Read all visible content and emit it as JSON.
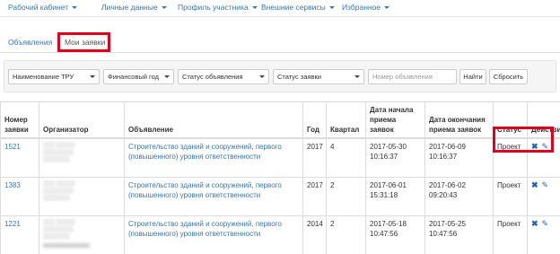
{
  "nav": {
    "items": [
      {
        "label": "Рабочий кабинет"
      },
      {
        "label": "Личные данные"
      },
      {
        "label": "Профиль участника"
      },
      {
        "label": "Внешние сервисы"
      },
      {
        "label": "Избранное"
      }
    ]
  },
  "tabs": [
    {
      "label": "Объявления"
    },
    {
      "label": "Мои заявки"
    }
  ],
  "filters": {
    "tru": "Наименование ТРУ",
    "fin_year": "Финансовый год",
    "announce_status": "Статус объявления",
    "request_status": "Статус заявки",
    "announce_number_placeholder": "Номер объявления",
    "find": "Найти",
    "reset": "Сбросить"
  },
  "table": {
    "headers": {
      "number": "Номер заявки",
      "organizer": "Организатор",
      "announcement": "Объявление",
      "year": "Год",
      "quarter": "Квартал",
      "start": "Дата начала приема заявок",
      "end": "Дата окончания приема заявок",
      "status": "Статус",
      "actions": "Действия"
    },
    "rows": [
      {
        "number": "1521",
        "announcement": "Строительство зданий и сооружений, первого (повышенного) уровня ответственности",
        "year": "2017",
        "quarter": "4",
        "start": "2017-05-30 10:16:37",
        "end": "2017-06-09 10:16:37",
        "status": "Проект"
      },
      {
        "number": "1383",
        "announcement": "Строительство зданий и сооружений, первого (повышенного) уровня ответственности",
        "year": "2017",
        "quarter": "2",
        "start": "2017-06-01 15:31:18",
        "end": "2017-06-02 09:20:43",
        "status": "Проект"
      },
      {
        "number": "1221",
        "announcement": "Строительство зданий и сооружений, первого (повышенного) уровня ответственности",
        "year": "2014",
        "quarter": "2",
        "start": "2017-05-18 10:47:56",
        "end": "2017-05-25 10:47:56",
        "status": "Проект"
      }
    ]
  },
  "colors": {
    "link": "#337ab7",
    "highlight": "#e3001b",
    "action": "#1d64c1"
  },
  "icons": {
    "delete": "close-icon",
    "edit": "pencil-icon",
    "dropdown": "caret-down-icon"
  }
}
